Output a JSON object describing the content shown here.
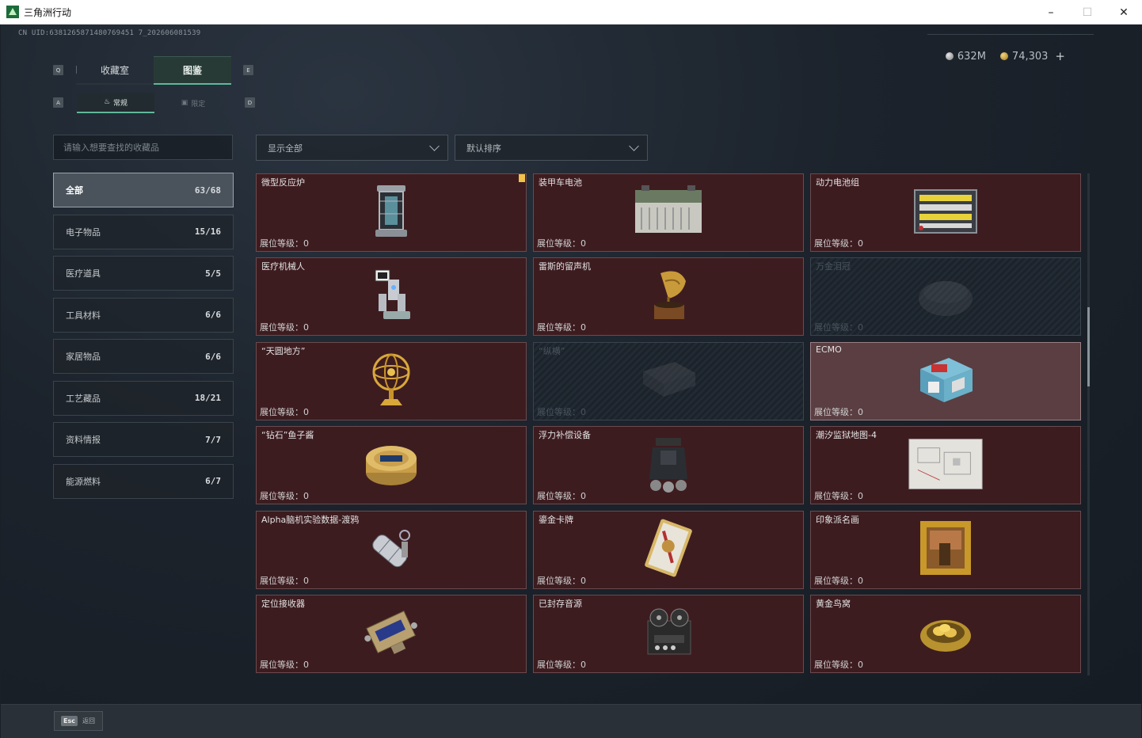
{
  "window": {
    "title": "三角洲行动",
    "min": "–",
    "max": "☐",
    "close": "✕"
  },
  "uid": "CN UID:6381265871480769451 7_202606081539",
  "currency": {
    "silver": "632M",
    "gold": "74,303",
    "plus": "+"
  },
  "keys": {
    "q": "Q",
    "e": "E",
    "a": "A",
    "d": "D"
  },
  "tabs": [
    {
      "label": "收藏室"
    },
    {
      "label": "图鉴"
    }
  ],
  "subtabs": [
    {
      "label": "常规",
      "icon": "♨"
    },
    {
      "label": "限定",
      "icon": "▣"
    }
  ],
  "search": {
    "placeholder": "请输入想要查找的收藏品"
  },
  "categories": [
    {
      "label": "全部",
      "count": "63/68"
    },
    {
      "label": "电子物品",
      "count": "15/16"
    },
    {
      "label": "医疗道具",
      "count": "5/5"
    },
    {
      "label": "工具材料",
      "count": "6/6"
    },
    {
      "label": "家居物品",
      "count": "6/6"
    },
    {
      "label": "工艺藏品",
      "count": "18/21"
    },
    {
      "label": "资料情报",
      "count": "7/7"
    },
    {
      "label": "能源燃料",
      "count": "6/7"
    }
  ],
  "filters": {
    "show": "显示全部",
    "sort": "默认排序"
  },
  "items": [
    {
      "name": "微型反应炉",
      "level": "展位等级：0",
      "icon": "reactor-icon"
    },
    {
      "name": "装甲车电池",
      "level": "展位等级：0",
      "icon": "battery-icon"
    },
    {
      "name": "动力电池组",
      "level": "展位等级：0",
      "icon": "battery-pack-icon"
    },
    {
      "name": "医疗机械人",
      "level": "展位等级：0",
      "icon": "medical-robot-icon"
    },
    {
      "name": "雷斯的留声机",
      "level": "展位等级：0",
      "icon": "gramophone-icon"
    },
    {
      "name": "万金泪冠",
      "level": "展位等级：0",
      "icon": "crown-icon"
    },
    {
      "name": "“天圆地方”",
      "level": "展位等级：0",
      "icon": "armillary-icon"
    },
    {
      "name": "“纵横”",
      "level": "展位等级：0",
      "icon": "case-icon"
    },
    {
      "name": "ECMO",
      "level": "展位等级：0",
      "icon": "ecmo-icon"
    },
    {
      "name": "“钻石”鱼子酱",
      "level": "展位等级：0",
      "icon": "caviar-icon"
    },
    {
      "name": "浮力补偿设备",
      "level": "展位等级：0",
      "icon": "buoyancy-icon"
    },
    {
      "name": "潮汐监狱地图-4",
      "level": "展位等级：0",
      "icon": "map-icon"
    },
    {
      "name": "Alpha脑机实验数据-渡鸦",
      "level": "展位等级：0",
      "icon": "data-capsule-icon"
    },
    {
      "name": "鎏金卡牌",
      "level": "展位等级：0",
      "icon": "card-icon"
    },
    {
      "name": "印象派名画",
      "level": "展位等级：0",
      "icon": "painting-icon"
    },
    {
      "name": "定位接收器",
      "level": "展位等级：0",
      "icon": "receiver-icon"
    },
    {
      "name": "已封存音源",
      "level": "展位等级：0",
      "icon": "tape-recorder-icon"
    },
    {
      "name": "黄金鸟窝",
      "level": "展位等级：0",
      "icon": "golden-nest-icon"
    }
  ],
  "footer": {
    "esc": "Esc",
    "back": "返回"
  },
  "colors": {
    "accent": "#5fb89a",
    "card": "#3d1c20",
    "badge": "#f0c24a"
  }
}
